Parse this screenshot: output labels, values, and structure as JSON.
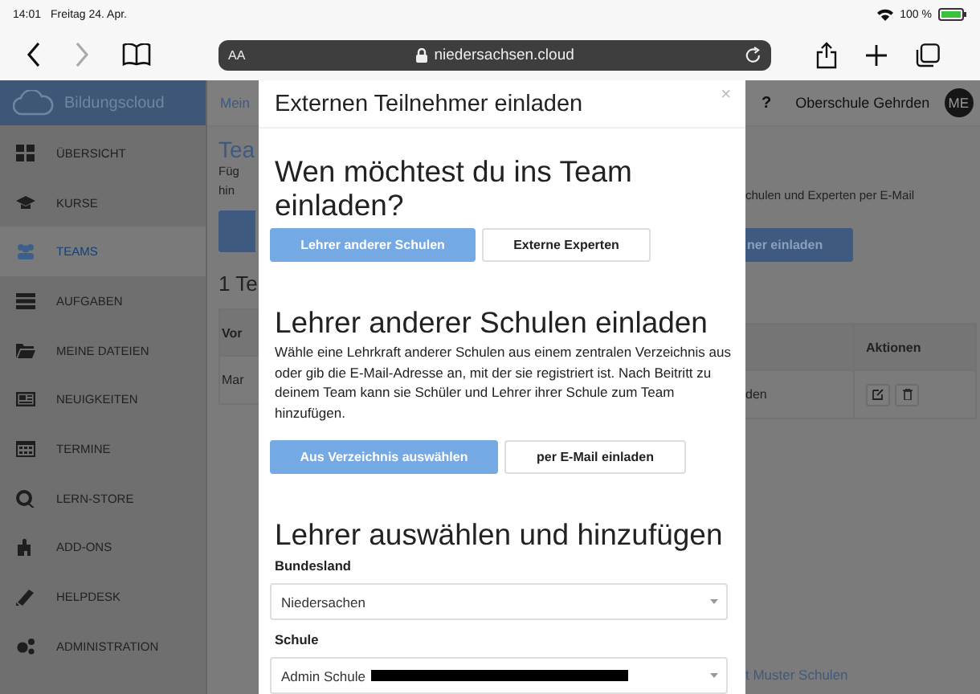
{
  "status_bar": {
    "time": "14:01",
    "date": "Freitag 24. Apr.",
    "battery": "100 %"
  },
  "browser": {
    "text_size": "AA",
    "url": "niedersachsen.cloud"
  },
  "sidebar": {
    "brand": "Bildungscloud",
    "items": [
      {
        "label": "ÜBERSICHT",
        "selected": false
      },
      {
        "label": "KURSE",
        "selected": false
      },
      {
        "label": "TEAMS",
        "selected": true
      },
      {
        "label": "AUFGABEN",
        "selected": false
      },
      {
        "label": "MEINE DATEIEN",
        "selected": false
      },
      {
        "label": "NEUIGKEITEN",
        "selected": false
      },
      {
        "label": "TERMINE",
        "selected": false
      },
      {
        "label": "LERN-STORE",
        "selected": false
      },
      {
        "label": "ADD-ONS",
        "selected": false
      },
      {
        "label": "HELPDESK",
        "selected": false
      },
      {
        "label": "ADMINISTRATION",
        "selected": false
      }
    ]
  },
  "background_left": {
    "breadcrumb": "Mein",
    "title": "Tea",
    "text_lines": [
      "Füg",
      "hin"
    ],
    "count": "1 Te",
    "table_header": "Vor",
    "table_cell": "Mar"
  },
  "background_right": {
    "help": "?",
    "school": "Oberschule Gehrden",
    "avatar": "ME",
    "text": "chulen und Experten per E-Mail",
    "button": "ner einladen",
    "table_header": "Aktionen",
    "table_cell": "den",
    "link": "t Muster Schulen"
  },
  "modal": {
    "title": "Externen Teilnehmer einladen",
    "close": "×",
    "question": "Wen möchtest du ins Team einladen?",
    "target_tabs": [
      {
        "label": "Lehrer anderer Schulen",
        "selected": true
      },
      {
        "label": "Externe Experten",
        "selected": false
      }
    ],
    "section_title": "Lehrer anderer Schulen einladen",
    "description": "Wähle eine Lehrkraft anderer Schulen aus einem zentralen Verzeichnis aus oder gib die E-Mail-Adresse an, mit der sie registriert ist. Nach Beitritt zu deinem Team kann sie Schüler und Lehrer ihrer Schule zum Team hinzufügen.",
    "method_tabs": [
      {
        "label": "Aus Verzeichnis auswählen",
        "selected": true
      },
      {
        "label": "per E-Mail einladen",
        "selected": false
      }
    ],
    "form_title": "Lehrer auswählen und hinzufügen",
    "fields": [
      {
        "label": "Bundesland",
        "value": "Niedersachen",
        "redacted": false
      },
      {
        "label": "Schule",
        "value": "Admin Schule",
        "redacted": true
      }
    ]
  }
}
